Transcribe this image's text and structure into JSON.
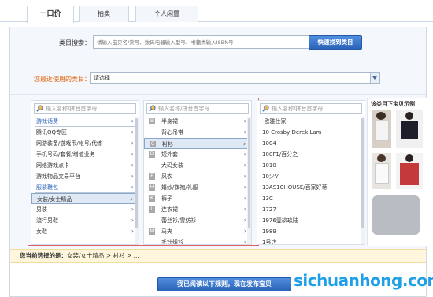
{
  "tabs": [
    {
      "label": "一口价",
      "active": true
    },
    {
      "label": "拍卖",
      "active": false
    },
    {
      "label": "个人闲置",
      "active": false
    }
  ],
  "search": {
    "label": "类目搜索：",
    "placeholder": "请输入宝贝名/货号、数码电器输入型号、书籍类输入ISBN号",
    "button": "快速找到类目"
  },
  "recent": {
    "label": "您最近使用的类目：",
    "value": "请选择"
  },
  "columns": {
    "col1": {
      "placeholder": "输入名称/拼音首字母",
      "items": [
        {
          "label": "游戏话费",
          "group": true
        },
        {
          "label": "腾讯QQ专区"
        },
        {
          "label": "网游装备/游戏币/帐号/代练"
        },
        {
          "label": "手机号码/套餐/增值业务"
        },
        {
          "label": "网络游戏点卡"
        },
        {
          "label": "游戏物品交易平台"
        },
        {
          "label": "服装鞋包",
          "group": true
        },
        {
          "label": "女装/女士精品",
          "selected": true
        },
        {
          "label": "男装"
        },
        {
          "label": "流行男鞋"
        },
        {
          "label": "女鞋"
        }
      ]
    },
    "col2": {
      "placeholder": "输入名称/拼音首字母",
      "items": [
        {
          "letter": "B",
          "label": "半身裙"
        },
        {
          "letter": "",
          "label": "背心吊带"
        },
        {
          "letter": "C",
          "label": "衬衫",
          "selected": true
        },
        {
          "letter": "D",
          "label": "短外套"
        },
        {
          "letter": "",
          "label": "大码女装"
        },
        {
          "letter": "F",
          "label": "风衣"
        },
        {
          "letter": "H",
          "label": "婚纱/旗袍/礼服"
        },
        {
          "letter": "K",
          "label": "裤子"
        },
        {
          "letter": "L",
          "label": "连衣裙"
        },
        {
          "letter": "",
          "label": "蕾丝衫/雪纺衫"
        },
        {
          "letter": "M",
          "label": "马夹"
        },
        {
          "letter": "",
          "label": "毛针织衫"
        }
      ]
    },
    "col3": {
      "placeholder": "输入名称/拼音首字母",
      "items": [
        "-欧雅仕家-",
        "10 Crosby Derek Lam",
        "1004",
        "100F1/百分之一",
        "1010",
        "10少V",
        "13AS1CHOUSE/百家好蒂",
        "13C",
        "1727",
        "1976壹玖玖陆",
        "1989",
        "1号店"
      ]
    }
  },
  "right_panel": {
    "title": "该类目下宝贝示例"
  },
  "current": {
    "label": "您当前选择的是：",
    "path": "女装/女士精品 > 衬衫 > ..."
  },
  "publish_button": "我已阅读以下规则，现在发布宝贝",
  "watermark": "sichuanhong.com",
  "colors": {
    "accent": "#2a63b8",
    "highlight_border": "#e2606a",
    "recent_label": "#e25a00",
    "watermark": "#1e9fe8"
  }
}
